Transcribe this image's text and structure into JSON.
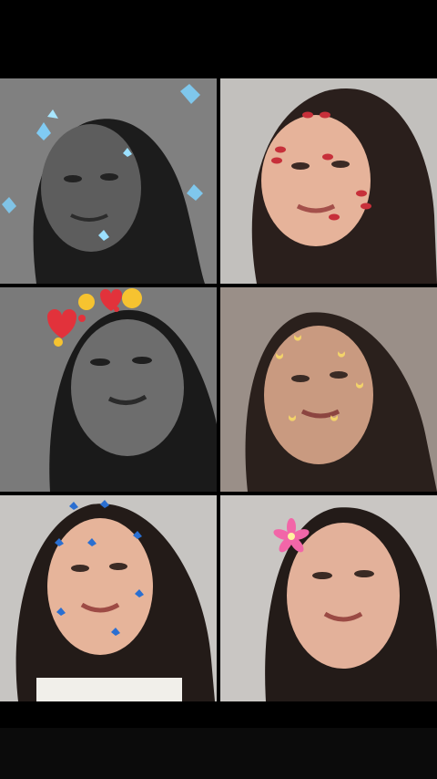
{
  "collage": {
    "tiles": [
      {
        "filter": "butterflies-glow",
        "tone": "grayscale"
      },
      {
        "filter": "lipstick-kisses",
        "tone": "warm"
      },
      {
        "filter": "emoji-crown",
        "tone": "grayscale"
      },
      {
        "filter": "moons",
        "tone": "warm"
      },
      {
        "filter": "blue-butterflies",
        "tone": "warm"
      },
      {
        "filter": "pink-flower",
        "tone": "warm"
      }
    ]
  }
}
